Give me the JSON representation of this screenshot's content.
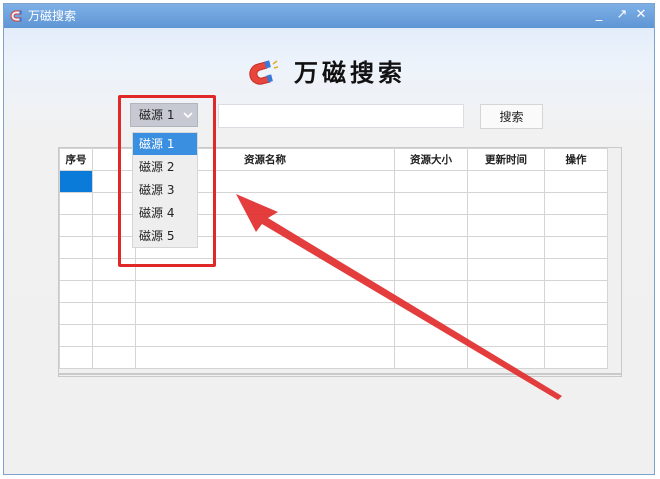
{
  "window": {
    "title": "万磁搜索",
    "minimize_glyph": "_",
    "maximize_glyph": "↗",
    "close_glyph": "✕"
  },
  "app": {
    "title": "万磁搜索",
    "logo_icon": "magnet-icon"
  },
  "search": {
    "source_selected": "磁源 1",
    "input_value": "",
    "input_placeholder": "",
    "button_label": "搜索"
  },
  "dropdown": {
    "options": [
      "磁源 1",
      "磁源 2",
      "磁源 3",
      "磁源 4",
      "磁源 5"
    ],
    "selected_index": 0
  },
  "table": {
    "columns": [
      "序号",
      "",
      "资源名称",
      "资源大小",
      "更新时间",
      "操作"
    ],
    "row_count": 9,
    "selected_cell_row": 0
  },
  "annotation": {
    "color": "#e02828"
  },
  "colors": {
    "titlebar": "#6fa3de",
    "selection": "#0a7bd8",
    "dropdown_highlight": "#3b8fe0",
    "annotation": "#e02828"
  }
}
